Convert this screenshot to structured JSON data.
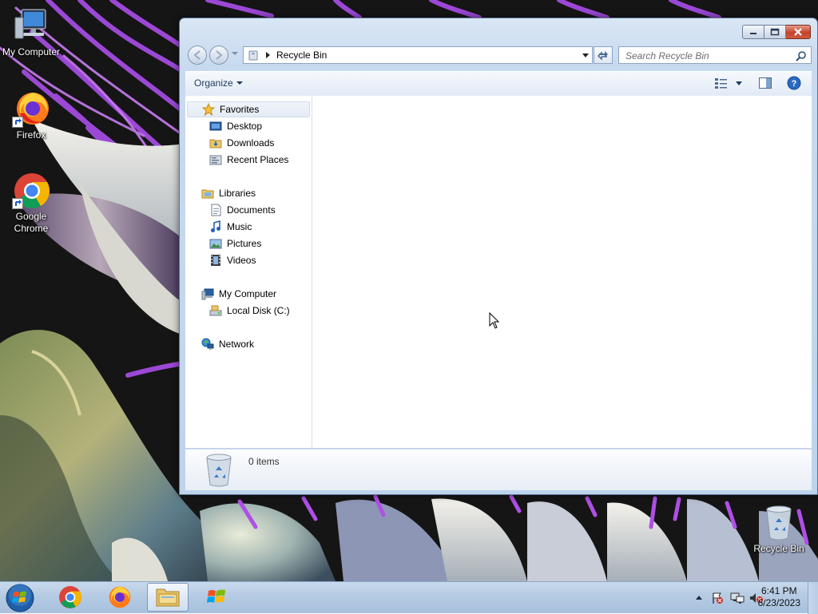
{
  "desktop": {
    "icons": [
      {
        "label": "My Computer"
      },
      {
        "label": "Firefox"
      },
      {
        "label": "Google Chrome"
      },
      {
        "label": "Recycle Bin"
      }
    ]
  },
  "window": {
    "address": {
      "path": "Recycle Bin"
    },
    "search": {
      "placeholder": "Search Recycle Bin"
    },
    "toolbar": {
      "organize_label": "Organize"
    },
    "nav_pane": {
      "favorites": {
        "label": "Favorites",
        "items": [
          "Desktop",
          "Downloads",
          "Recent Places"
        ]
      },
      "libraries": {
        "label": "Libraries",
        "items": [
          "Documents",
          "Music",
          "Pictures",
          "Videos"
        ]
      },
      "computer": {
        "label": "My Computer",
        "items": [
          "Local Disk (C:)"
        ]
      },
      "network": {
        "label": "Network"
      }
    },
    "details": {
      "item_count": "0 items"
    }
  },
  "taskbar": {
    "clock": {
      "time": "6:41 PM",
      "date": "6/23/2023"
    }
  },
  "colors": {
    "accent": "#1e3a5f",
    "close_button": "#c4432b",
    "taskbar": "#b5cbe3",
    "wallpaper_flower": "#9a3fd6"
  }
}
